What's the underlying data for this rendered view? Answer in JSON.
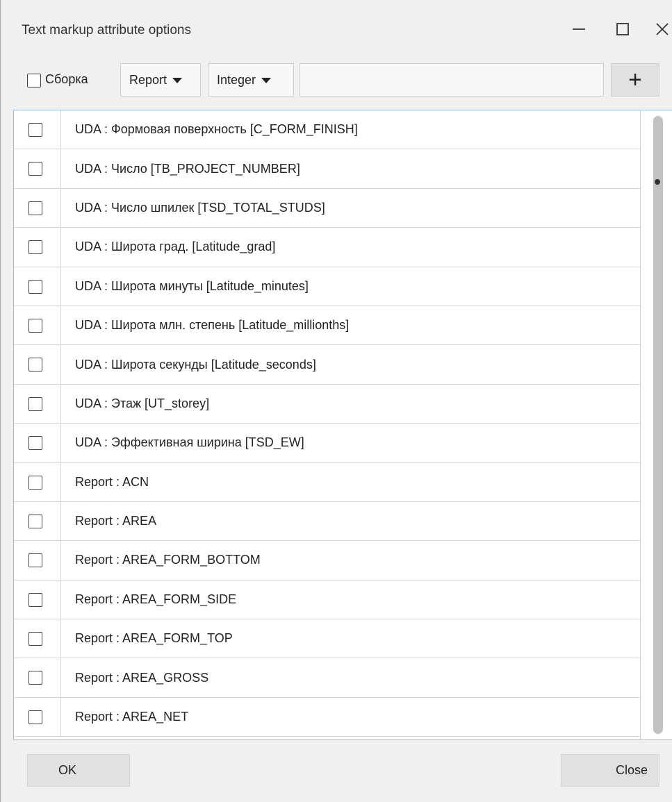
{
  "window": {
    "title": "Text markup attribute options",
    "minimize_icon": "minimize-icon",
    "maximize_icon": "maximize-icon",
    "close_icon": "close-icon"
  },
  "toolbar": {
    "assembly_checkbox_label": "Сборка",
    "assembly_checked": false,
    "source_dropdown": "Report",
    "type_dropdown": "Integer",
    "text_input_value": "",
    "add_button_label": "+"
  },
  "list": {
    "items": [
      {
        "label": "UDA : Формовая поверхность [C_FORM_FINISH]",
        "checked": false
      },
      {
        "label": "UDA : Число [TB_PROJECT_NUMBER]",
        "checked": false
      },
      {
        "label": "UDA : Число шпилек [TSD_TOTAL_STUDS]",
        "checked": false
      },
      {
        "label": "UDA : Широта град. [Latitude_grad]",
        "checked": false
      },
      {
        "label": "UDA : Широта минуты [Latitude_minutes]",
        "checked": false
      },
      {
        "label": "UDA : Широта млн. степень [Latitude_millionths]",
        "checked": false
      },
      {
        "label": "UDA : Широта секунды [Latitude_seconds]",
        "checked": false
      },
      {
        "label": "UDA : Этаж [UT_storey]",
        "checked": false
      },
      {
        "label": "UDA : Эффективная ширина [TSD_EW]",
        "checked": false
      },
      {
        "label": "Report : ACN",
        "checked": false
      },
      {
        "label": "Report : AREA",
        "checked": false
      },
      {
        "label": "Report : AREA_FORM_BOTTOM",
        "checked": false
      },
      {
        "label": "Report : AREA_FORM_SIDE",
        "checked": false
      },
      {
        "label": "Report : AREA_FORM_TOP",
        "checked": false
      },
      {
        "label": "Report : AREA_GROSS",
        "checked": false
      },
      {
        "label": "Report : AREA_NET",
        "checked": false
      }
    ]
  },
  "footer": {
    "ok_label": "OK",
    "close_label": "Close"
  },
  "colors": {
    "window_bg": "#f0f0f0",
    "list_bg": "#ffffff",
    "list_border": "#9bbad6",
    "button_bg": "#e1e1e1"
  }
}
